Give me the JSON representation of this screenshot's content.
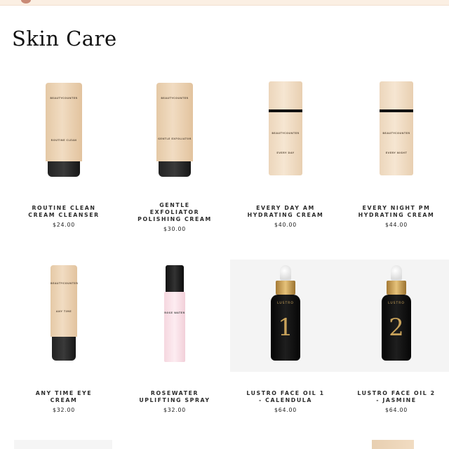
{
  "page": {
    "title": "Skin Care"
  },
  "products": [
    {
      "name": "ROUTINE CLEAN\nCREAM CLEANSER",
      "price": "$24.00",
      "icon": "tube"
    },
    {
      "name": "GENTLE\nEXFOLIATOR\nPOLISHING CREAM",
      "price": "$30.00",
      "icon": "tube"
    },
    {
      "name": "EVERY DAY AM\nHYDRATING CREAM",
      "price": "$40.00",
      "icon": "bottle"
    },
    {
      "name": "EVERY NIGHT PM\nHYDRATING CREAM",
      "price": "$44.00",
      "icon": "bottle"
    },
    {
      "name": "ANY TIME EYE\nCREAM",
      "price": "$32.00",
      "icon": "small-tube"
    },
    {
      "name": "ROSEWATER\nUPLIFTING SPRAY",
      "price": "$32.00",
      "icon": "spray-bottle"
    },
    {
      "name": "LUSTRO FACE OIL 1\n- CALENDULA",
      "price": "$64.00",
      "icon": "dropper-bottle"
    },
    {
      "name": "LUSTRO FACE OIL 2\n- JASMINE",
      "price": "$64.00",
      "icon": "dropper-bottle"
    }
  ],
  "product_labels": {
    "brand": "BEAUTYCOUNTER",
    "tube1": "ROUTINE CLEAN",
    "tube2": "GENTLE EXFOLIATOR",
    "bottle1": "EVERY DAY",
    "bottle2": "EVERY NIGHT",
    "eye": "ANY TIME",
    "spray": "ROSE WATER",
    "oil_word": "LUSTRO",
    "oil1_num": "1",
    "oil2_num": "2"
  },
  "colors": {
    "accent": "#c98a76",
    "banner": "#fbefe3",
    "gold": "#c9a35b"
  }
}
